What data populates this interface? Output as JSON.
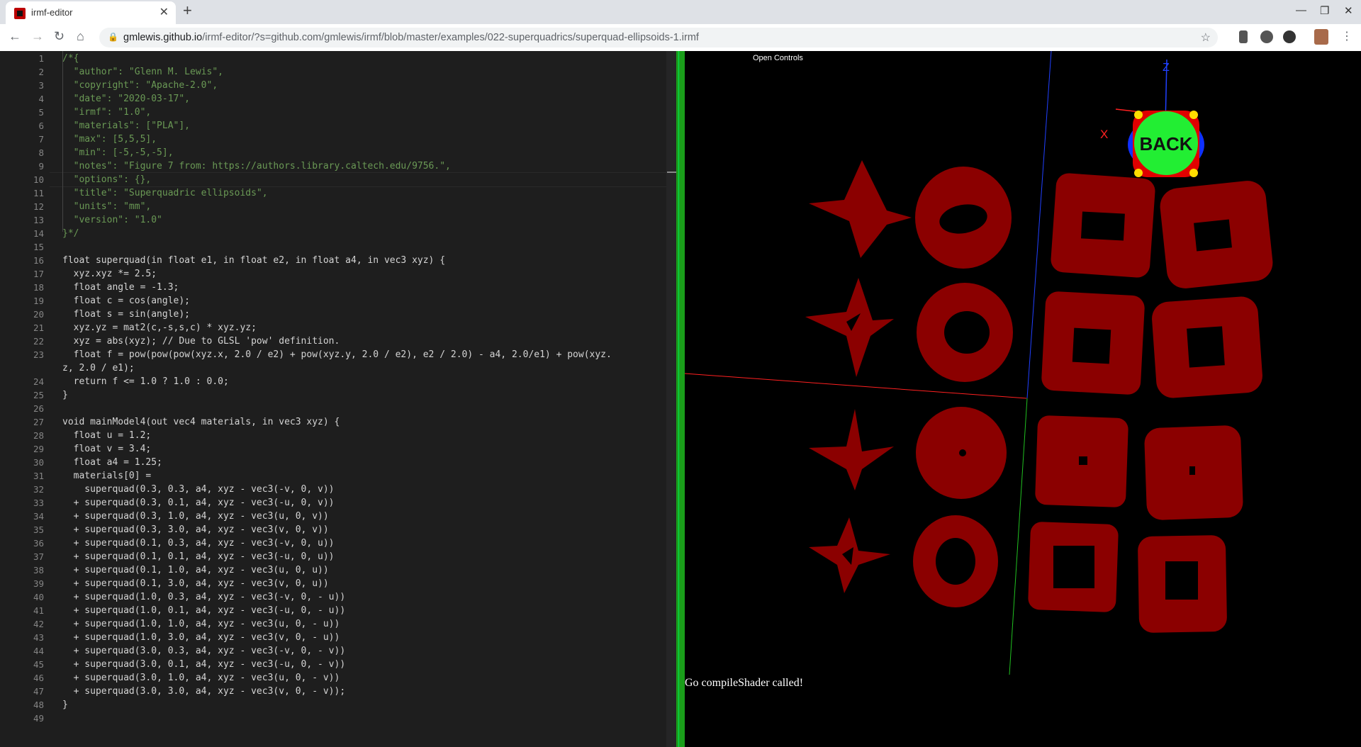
{
  "browser": {
    "tab_title": "irmf-editor",
    "new_tab": "+",
    "url_host": "gmlewis.github.io",
    "url_path": "/irmf-editor/?s=github.com/gmlewis/irmf/blob/master/examples/022-superquadrics/superquad-ellipsoids-1.irmf"
  },
  "editor": {
    "lines": [
      {
        "n": "1",
        "t": "/*{",
        "k": "c"
      },
      {
        "n": "2",
        "t": "  \"author\": \"Glenn M. Lewis\",",
        "k": "c"
      },
      {
        "n": "3",
        "t": "  \"copyright\": \"Apache-2.0\",",
        "k": "c"
      },
      {
        "n": "4",
        "t": "  \"date\": \"2020-03-17\",",
        "k": "c"
      },
      {
        "n": "5",
        "t": "  \"irmf\": \"1.0\",",
        "k": "c"
      },
      {
        "n": "6",
        "t": "  \"materials\": [\"PLA\"],",
        "k": "c"
      },
      {
        "n": "7",
        "t": "  \"max\": [5,5,5],",
        "k": "c"
      },
      {
        "n": "8",
        "t": "  \"min\": [-5,-5,-5],",
        "k": "c"
      },
      {
        "n": "9",
        "t": "  \"notes\": \"Figure 7 from: https://authors.library.caltech.edu/9756.\",",
        "k": "c"
      },
      {
        "n": "10",
        "t": "  \"options\": {},",
        "k": "c"
      },
      {
        "n": "11",
        "t": "  \"title\": \"Superquadric ellipsoids\",",
        "k": "c"
      },
      {
        "n": "12",
        "t": "  \"units\": \"mm\",",
        "k": "c"
      },
      {
        "n": "13",
        "t": "  \"version\": \"1.0\"",
        "k": "c"
      },
      {
        "n": "14",
        "t": "}*/",
        "k": "c"
      },
      {
        "n": "15",
        "t": "",
        "k": ""
      },
      {
        "n": "16",
        "t": "float superquad(in float e1, in float e2, in float a4, in vec3 xyz) {",
        "k": ""
      },
      {
        "n": "17",
        "t": "  xyz.xyz *= 2.5;",
        "k": ""
      },
      {
        "n": "18",
        "t": "  float angle = -1.3;",
        "k": ""
      },
      {
        "n": "19",
        "t": "  float c = cos(angle);",
        "k": ""
      },
      {
        "n": "20",
        "t": "  float s = sin(angle);",
        "k": ""
      },
      {
        "n": "21",
        "t": "  xyz.yz = mat2(c,-s,s,c) * xyz.yz;",
        "k": ""
      },
      {
        "n": "22",
        "t": "  xyz = abs(xyz); // Due to GLSL 'pow' definition.",
        "k": ""
      },
      {
        "n": "23",
        "t": "  float f = pow(pow(pow(xyz.x, 2.0 / e2) + pow(xyz.y, 2.0 / e2), e2 / 2.0) - a4, 2.0/e1) + pow(xyz.",
        "k": ""
      },
      {
        "n": "",
        "t": "z, 2.0 / e1);",
        "k": ""
      },
      {
        "n": "24",
        "t": "  return f <= 1.0 ? 1.0 : 0.0;",
        "k": ""
      },
      {
        "n": "25",
        "t": "}",
        "k": ""
      },
      {
        "n": "26",
        "t": "",
        "k": ""
      },
      {
        "n": "27",
        "t": "void mainModel4(out vec4 materials, in vec3 xyz) {",
        "k": ""
      },
      {
        "n": "28",
        "t": "  float u = 1.2;",
        "k": ""
      },
      {
        "n": "29",
        "t": "  float v = 3.4;",
        "k": ""
      },
      {
        "n": "30",
        "t": "  float a4 = 1.25;",
        "k": ""
      },
      {
        "n": "31",
        "t": "  materials[0] =",
        "k": ""
      },
      {
        "n": "32",
        "t": "    superquad(0.3, 0.3, a4, xyz - vec3(-v, 0, v))",
        "k": ""
      },
      {
        "n": "33",
        "t": "  + superquad(0.3, 0.1, a4, xyz - vec3(-u, 0, v))",
        "k": ""
      },
      {
        "n": "34",
        "t": "  + superquad(0.3, 1.0, a4, xyz - vec3(u, 0, v))",
        "k": ""
      },
      {
        "n": "35",
        "t": "  + superquad(0.3, 3.0, a4, xyz - vec3(v, 0, v))",
        "k": ""
      },
      {
        "n": "36",
        "t": "  + superquad(0.1, 0.3, a4, xyz - vec3(-v, 0, u))",
        "k": ""
      },
      {
        "n": "37",
        "t": "  + superquad(0.1, 0.1, a4, xyz - vec3(-u, 0, u))",
        "k": ""
      },
      {
        "n": "38",
        "t": "  + superquad(0.1, 1.0, a4, xyz - vec3(u, 0, u))",
        "k": ""
      },
      {
        "n": "39",
        "t": "  + superquad(0.1, 3.0, a4, xyz - vec3(v, 0, u))",
        "k": ""
      },
      {
        "n": "40",
        "t": "  + superquad(1.0, 0.3, a4, xyz - vec3(-v, 0, - u))",
        "k": ""
      },
      {
        "n": "41",
        "t": "  + superquad(1.0, 0.1, a4, xyz - vec3(-u, 0, - u))",
        "k": ""
      },
      {
        "n": "42",
        "t": "  + superquad(1.0, 1.0, a4, xyz - vec3(u, 0, - u))",
        "k": ""
      },
      {
        "n": "43",
        "t": "  + superquad(1.0, 3.0, a4, xyz - vec3(v, 0, - u))",
        "k": ""
      },
      {
        "n": "44",
        "t": "  + superquad(3.0, 0.3, a4, xyz - vec3(-v, 0, - v))",
        "k": ""
      },
      {
        "n": "45",
        "t": "  + superquad(3.0, 0.1, a4, xyz - vec3(-u, 0, - v))",
        "k": ""
      },
      {
        "n": "46",
        "t": "  + superquad(3.0, 1.0, a4, xyz - vec3(u, 0, - v))",
        "k": ""
      },
      {
        "n": "47",
        "t": "  + superquad(3.0, 3.0, a4, xyz - vec3(v, 0, - v));",
        "k": ""
      },
      {
        "n": "48",
        "t": "}",
        "k": ""
      },
      {
        "n": "49",
        "t": "",
        "k": ""
      }
    ]
  },
  "viewer": {
    "open_controls": "Open Controls",
    "console_message": "Go compileShader called!",
    "axis_x_label": "X",
    "axis_z_label": "Z",
    "cube_face_label": "BACK",
    "shape_color": "#8b0000",
    "axis_colors": {
      "x": "#ff2020",
      "y": "#20c020",
      "z": "#2040ff"
    }
  },
  "colors": {
    "editor_bg": "#1e1e1e",
    "splitter": "#1a9e1a",
    "comment": "#6a9955"
  }
}
